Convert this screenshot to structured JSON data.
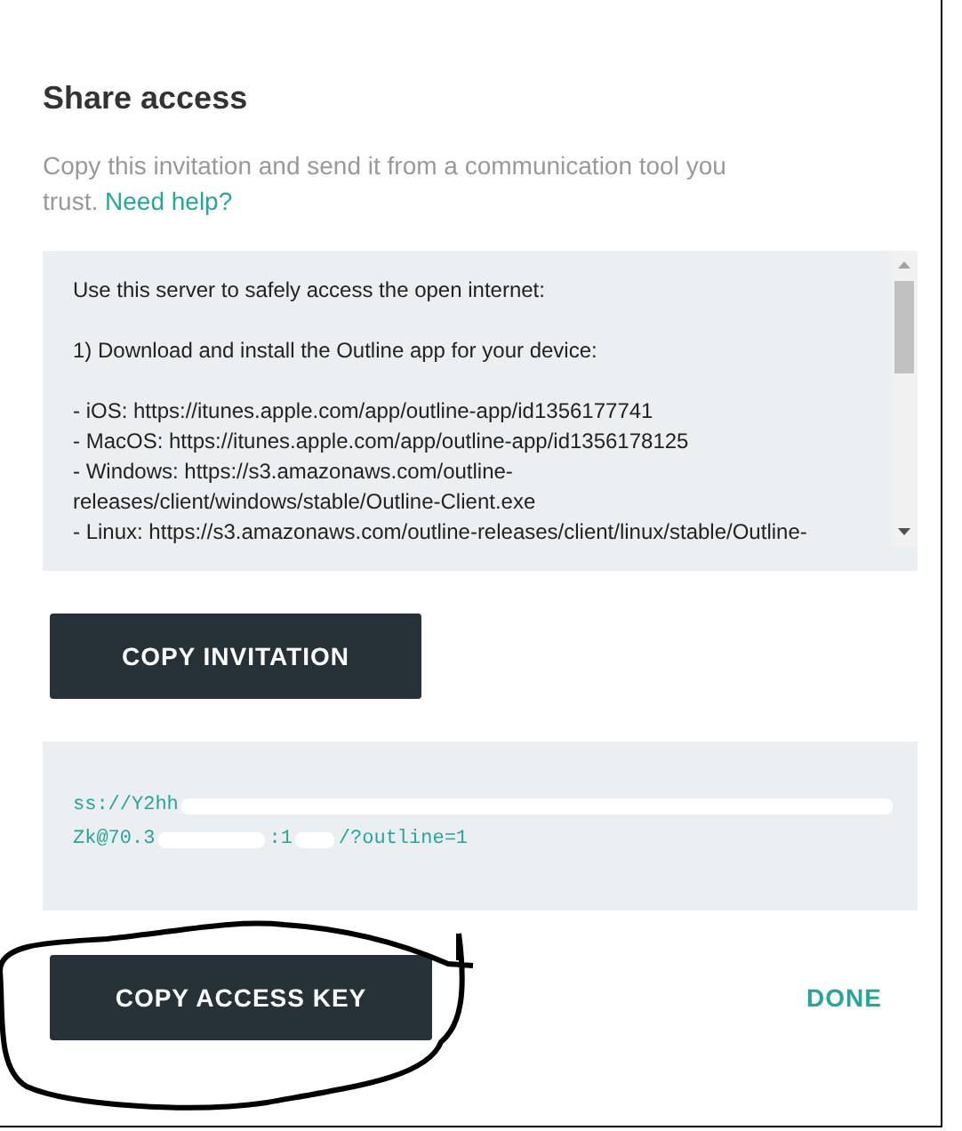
{
  "dialog": {
    "title": "Share access",
    "description": "Copy this invitation and send it from a communication tool you trust.",
    "help_link": "Need help?"
  },
  "invitation": {
    "paragraphs": [
      [
        "Use this server to safely access the open internet:"
      ],
      [
        "1) Download and install the Outline app for your device:"
      ],
      [
        "- iOS: https://itunes.apple.com/app/outline-app/id1356177741",
        "- MacOS: https://itunes.apple.com/app/outline-app/id1356178125",
        "- Windows: https://s3.amazonaws.com/outline-",
        "releases/client/windows/stable/Outline-Client.exe",
        "- Linux: https://s3.amazonaws.com/outline-releases/client/linux/stable/Outline-"
      ]
    ]
  },
  "copy_invitation_button": "COPY INVITATION",
  "access_key": {
    "line_1": [
      "ss://Y2hh"
    ],
    "line_2": [
      "Zk@70.3",
      ":1",
      "/?outline=1"
    ]
  },
  "buttons": [
    {
      "label": "COPY ACCESS KEY",
      "kind": "primary"
    },
    {
      "label": "DONE",
      "kind": "text"
    }
  ]
}
